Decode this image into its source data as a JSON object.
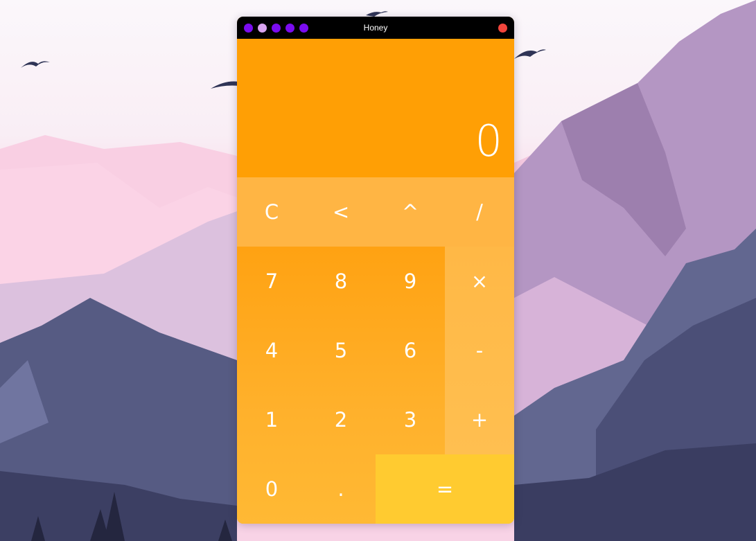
{
  "window": {
    "title": "Honey",
    "theme_dots": [
      {
        "name": "theme-dot-purple-1",
        "color": "#7a0cf0"
      },
      {
        "name": "theme-dot-lavender",
        "color": "#d9a5f0"
      },
      {
        "name": "theme-dot-purple-2",
        "color": "#7a0cf0"
      },
      {
        "name": "theme-dot-purple-3",
        "color": "#7a0cf0"
      },
      {
        "name": "theme-dot-purple-4",
        "color": "#7a0cf0"
      }
    ],
    "close_color": "#f2453c",
    "close_icon": "close-icon"
  },
  "display": {
    "value": "0"
  },
  "keys": {
    "clear": "C",
    "backspace": "<",
    "power": "^",
    "divide": "/",
    "seven": "7",
    "eight": "8",
    "nine": "9",
    "multiply": "×",
    "four": "4",
    "five": "5",
    "six": "6",
    "subtract": "-",
    "one": "1",
    "two": "2",
    "three": "3",
    "add": "+",
    "zero": "0",
    "decimal": ".",
    "equals": "="
  },
  "colors": {
    "display_bg": "#ff9f05",
    "function_row_bg": "#ffb544",
    "number_pad_bg": "#ffa212",
    "operator_col_bg": "#ffb846",
    "equals_bg": "#ffcb30",
    "text": "#ffffff"
  }
}
